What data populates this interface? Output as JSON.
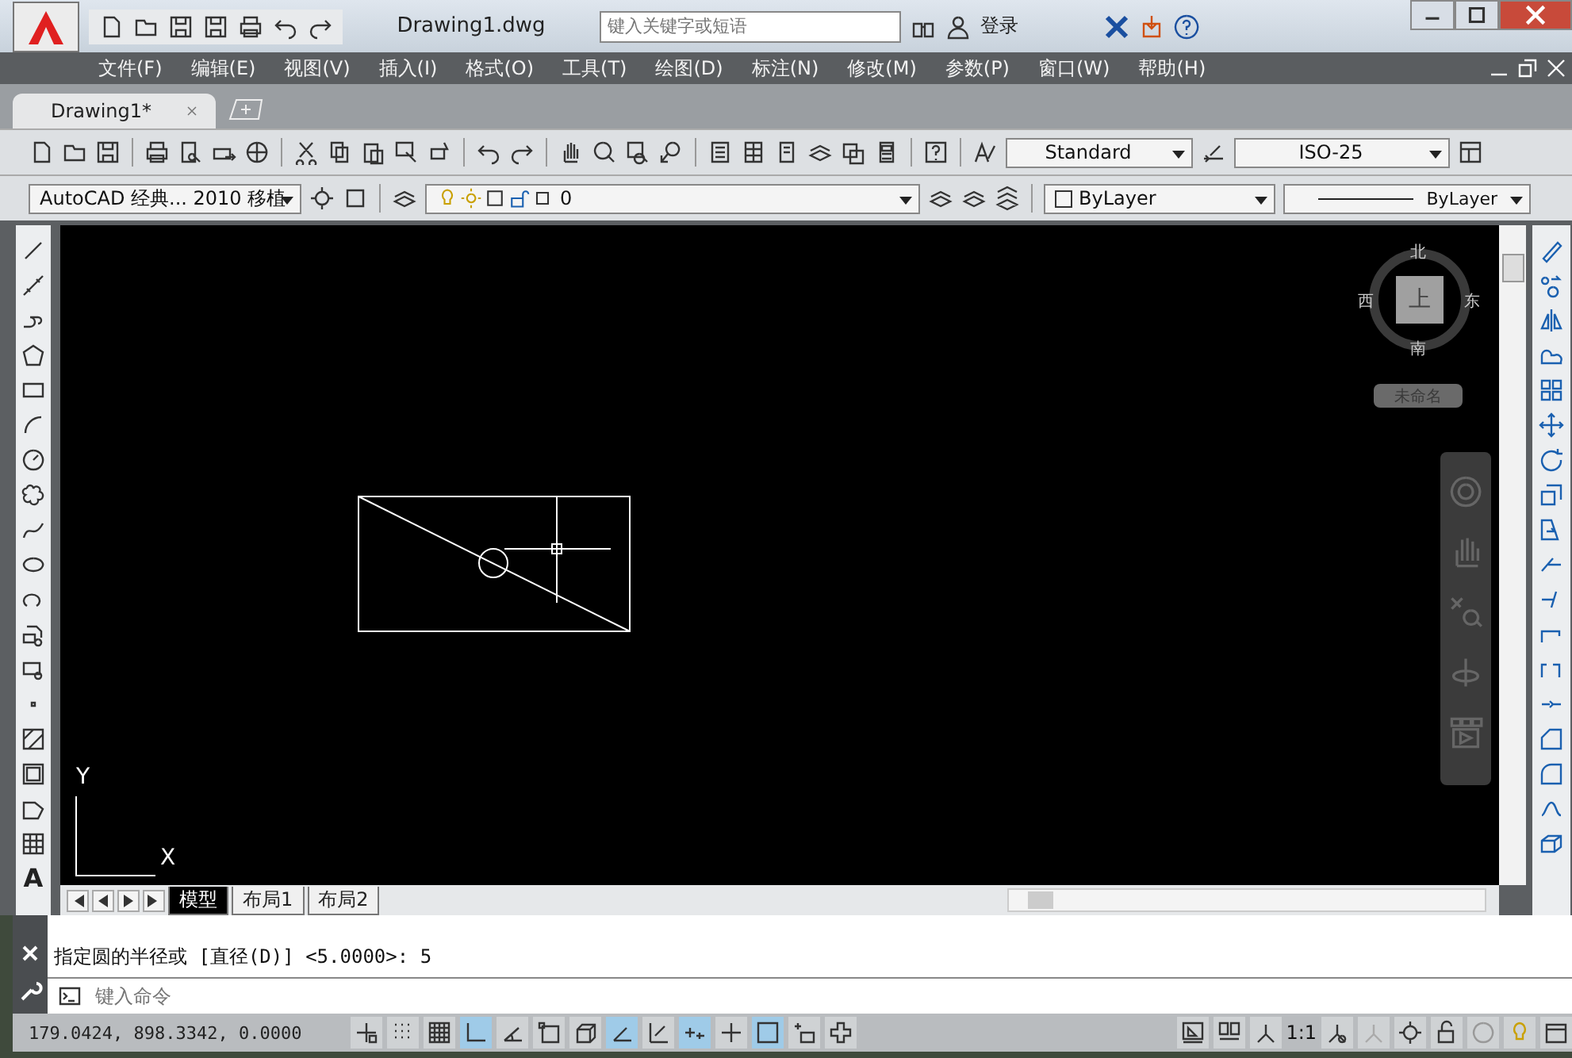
{
  "title_bar": {
    "file_title": "Drawing1.dwg",
    "search": {
      "placeholder": "键入关键字或短语"
    },
    "login": "登录"
  },
  "menu": [
    {
      "label": "文件(F)"
    },
    {
      "label": "编辑(E)"
    },
    {
      "label": "视图(V)"
    },
    {
      "label": "插入(I)"
    },
    {
      "label": "格式(O)"
    },
    {
      "label": "工具(T)"
    },
    {
      "label": "绘图(D)"
    },
    {
      "label": "标注(N)"
    },
    {
      "label": "修改(M)"
    },
    {
      "label": "参数(P)"
    },
    {
      "label": "窗口(W)"
    },
    {
      "label": "帮助(H)"
    }
  ],
  "document_tabs": [
    {
      "label": "Drawing1*",
      "selected": true
    }
  ],
  "standard_toolbar": {
    "text_style": "Standard",
    "dim_style": "ISO-25"
  },
  "layer_bar": {
    "workspace": "AutoCAD 经典... 2010 移植",
    "layer": "0",
    "color_setting": "ByLayer",
    "linetype": "ByLayer"
  },
  "draw_toolbar": {
    "text_tool_glyph": "A"
  },
  "viewcube": {
    "north": "北",
    "south": "南",
    "east": "东",
    "west": "西",
    "top": "上",
    "ucs": "未命名"
  },
  "ucs_icon": {
    "y": "Y",
    "x": "X"
  },
  "layout_tabs": [
    {
      "label": "模型",
      "selected": true
    },
    {
      "label": "布局1",
      "selected": false
    },
    {
      "label": "布局2",
      "selected": false
    }
  ],
  "command": {
    "history": "指定圆的半径或 [直径(D)] <5.0000>: 5",
    "placeholder": "键入命令"
  },
  "status_bar": {
    "coordinates": "179.0424, 898.3342, 0.0000",
    "scale": "1:1",
    "toggles": [
      {
        "on": false
      },
      {
        "on": false
      },
      {
        "on": false
      },
      {
        "on": true
      },
      {
        "on": false
      },
      {
        "on": false
      },
      {
        "on": false
      },
      {
        "on": true
      },
      {
        "on": false
      },
      {
        "on": true
      },
      {
        "on": false
      },
      {
        "on": true
      },
      {
        "on": false
      },
      {
        "on": false
      }
    ]
  }
}
